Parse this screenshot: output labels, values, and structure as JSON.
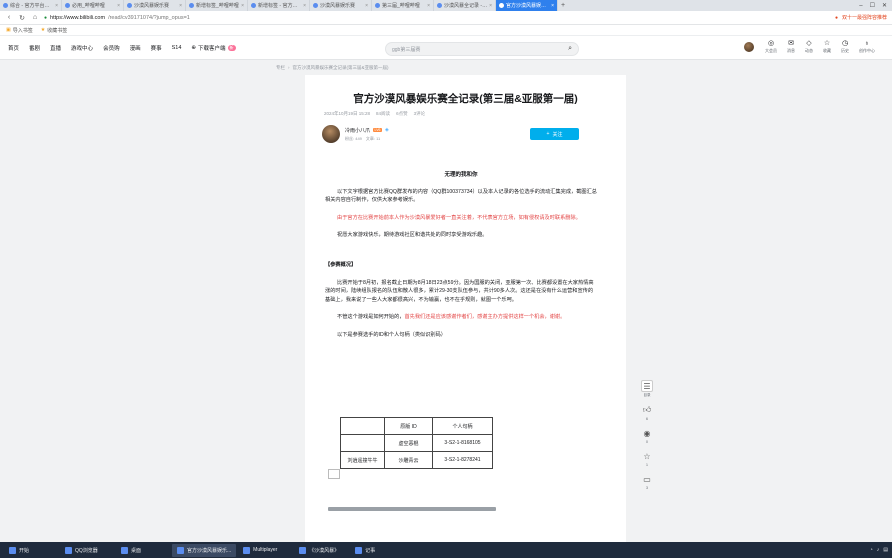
{
  "browser": {
    "tabs": [
      {
        "label": "综合 - 官方平台播放器"
      },
      {
        "label": "必用_哔哩哔哩"
      },
      {
        "label": "沙漠风暴娱乐赛"
      },
      {
        "label": "新增标签_哔哩哔哩"
      },
      {
        "label": "新增标签 - 官方平台"
      },
      {
        "label": "沙漠风暴娱乐赛"
      },
      {
        "label": "第三届_哔哩哔哩"
      },
      {
        "label": "沙漠风暴全记录 - 哔哩"
      },
      {
        "label": "官方沙漠风暴娱乐赛全记录",
        "active": true
      }
    ],
    "new_tab": "+",
    "url_host": "https://www.bilibili.com",
    "url_path": "/read/cv39171074/?jump_opus=1",
    "hot_search": "双十一最强阵容推荐"
  },
  "bookmarks": [
    {
      "label": "导入书签"
    },
    {
      "label": "收藏书签"
    }
  ],
  "site_nav": {
    "items": [
      "首页",
      "番剧",
      "直播",
      "游戏中心",
      "会员购",
      "漫画",
      "赛事",
      "S14"
    ],
    "download_label": "下载客户端",
    "download_badge": "新",
    "search_placeholder": "ggb第三届赛",
    "user_items": [
      "大会员",
      "消息",
      "动态",
      "收藏",
      "历史",
      "创作中心"
    ]
  },
  "breadcrumb": [
    "专栏",
    "官方沙漠风暴娱乐赛全记录(第三届&亚服第一届)"
  ],
  "article": {
    "title": "官方沙漠风暴娱乐赛全记录(第三届&亚服第一届)",
    "meta": [
      "2024年10月19日 15:28",
      "84阅读",
      "6点赞",
      "3评论"
    ],
    "author": {
      "name": "冷雨小八爪",
      "level": "LV6",
      "stats": [
        "粉丝: 449",
        "文章: 11"
      ]
    },
    "follow_label": "关注",
    "heading": "无理的我和你",
    "paragraphs": [
      {
        "text": "以下文字根据官方比赛QQ群发布的内容（QQ群100373734）以及本人记录的各位选手的流动汇集完成，截图汇总相关内容自行制作，仅供大家参考娱乐。",
        "red": false
      },
      {
        "text": "由于官方在比赛开始前本人作为沙漠风暴爱好者一直关注着，不代表官方立场，如有侵权请及时联系删除。",
        "red": true
      },
      {
        "text": "祝愿大家游戏快乐，期待游戏社区和谐共处的同时享受游戏乐趣。",
        "red": false
      }
    ],
    "section_title": "【参赛概况】",
    "paragraph_2": "比赛开始于8月初，报名截止日期为8月18日23点59分。因为国服的关闭，亚服第一次、比赛都设置在大家热情高涨的时间，陆续组队报名的队伍和散人很多，累计29-30支队伍参与，共计90多人次。这还是在没有什么运营和宣传的基础上，我来说了一些人大家都很高兴，不为输赢，也不在乎规则，就图一个乐呵。",
    "paragraph_3_prefix": "不管这个游戏是如何开始的，",
    "paragraph_3_red": "首先我们还是应该感谢作者们，感谢主办方提供这样一个机会，谢谢。",
    "paragraph_4": "以下是参赛选手的ID和个人句柄（类似识别码）",
    "table": {
      "header": [
        "",
        "原版 ID",
        "个人句柄"
      ],
      "rows": [
        [
          "",
          "虚空恶棍",
          "3-S2-1-8168105"
        ],
        [
          "刘逍遥撞牛牛",
          "沙雕青云",
          "3-S2-1-8278241"
        ]
      ]
    }
  },
  "side_actions": [
    {
      "icon": "article-list-icon",
      "label": "目录"
    },
    {
      "icon": "thumb-up-icon",
      "label": "6"
    },
    {
      "icon": "coin-icon",
      "label": "0"
    },
    {
      "icon": "star-icon",
      "label": "1"
    },
    {
      "icon": "comment-icon",
      "label": "3"
    }
  ],
  "taskbar": {
    "items": [
      {
        "label": "开始"
      },
      {
        "label": "QQ浏览器"
      },
      {
        "label": "桌面"
      },
      {
        "label": "官方沙漠风暴娱乐...",
        "active": true
      },
      {
        "label": "Multiplayer"
      },
      {
        "label": "《沙漠风暴》"
      },
      {
        "label": "记事"
      }
    ]
  },
  "colors": {
    "accent": "#00aeec",
    "red_text": "#e34545",
    "tab_active": "#2f80ed"
  }
}
